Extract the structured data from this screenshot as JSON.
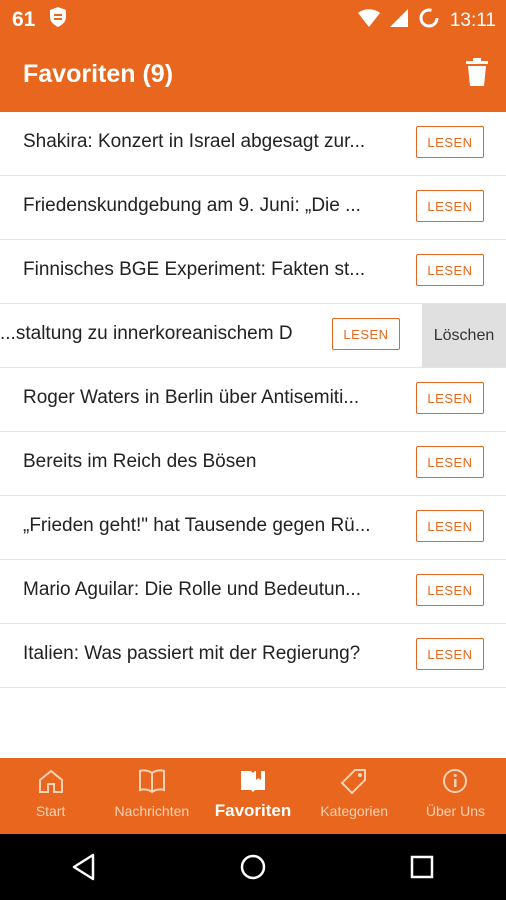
{
  "status": {
    "left_number": "61",
    "time": "13:11"
  },
  "appbar": {
    "title": "Favoriten (9)"
  },
  "read_label": "LESEN",
  "delete_label": "Löschen",
  "items": [
    "Shakira: Konzert in Israel abgesagt zur...",
    "Friedenskundgebung am 9. Juni: „Die ...",
    "Finnisches BGE Experiment: Fakten st...",
    "staltung zu innerkoreanischem D...",
    "Roger Waters in Berlin über Antisemiti...",
    "Bereits im Reich des Bösen",
    "„Frieden geht!\" hat Tausende gegen Rü...",
    "Mario Aguilar: Die Rolle und Bedeutun...",
    "Italien: Was passiert mit der Regierung?"
  ],
  "nav": [
    "Start",
    "Nachrichten",
    "Favoriten",
    "Kategorien",
    "Über Uns"
  ],
  "colors": {
    "brand": "#e8661d",
    "nav_inactive": "#fbd2b6"
  }
}
